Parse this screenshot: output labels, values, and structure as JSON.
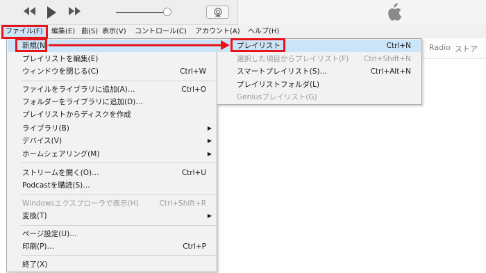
{
  "player": {
    "rewind_icon": "rewind-icon",
    "play_icon": "play-icon",
    "forward_icon": "fast-forward-icon",
    "airplay_icon": "airplay-icon",
    "apple_icon": "apple-logo",
    "volume_level": 0.92
  },
  "menubar": {
    "items": [
      "ファイル(F)",
      "編集(E)",
      "曲(S)",
      "表示(V)",
      "コントロール(C)",
      "アカウント(A)",
      "ヘルプ(H)"
    ]
  },
  "nav": {
    "radio": "Radio",
    "store": "ストア"
  },
  "file_menu": {
    "items": [
      {
        "label": "新規(N)",
        "shortcut": ""
      },
      {
        "label": "プレイリストを編集(E)",
        "shortcut": ""
      },
      {
        "label": "ウィンドウを閉じる(C)",
        "shortcut": "Ctrl+W"
      },
      {
        "label": "ファイルをライブラリに追加(A)…",
        "shortcut": "Ctrl+O"
      },
      {
        "label": "フォルダーをライブラリに追加(D)…",
        "shortcut": ""
      },
      {
        "label": "プレイリストからディスクを作成",
        "shortcut": ""
      },
      {
        "label": "ライブラリ(B)",
        "shortcut": ""
      },
      {
        "label": "デバイス(V)",
        "shortcut": ""
      },
      {
        "label": "ホームシェアリング(M)",
        "shortcut": ""
      },
      {
        "label": "ストリームを開く(O)…",
        "shortcut": "Ctrl+U"
      },
      {
        "label": "Podcastを購読(S)…",
        "shortcut": ""
      },
      {
        "label": "Windowsエクスプローラで表示(H)",
        "shortcut": "Ctrl+Shift+R"
      },
      {
        "label": "変換(T)",
        "shortcut": ""
      },
      {
        "label": "ページ設定(U)…",
        "shortcut": ""
      },
      {
        "label": "印刷(P)…",
        "shortcut": "Ctrl+P"
      },
      {
        "label": "終了(X)",
        "shortcut": ""
      }
    ]
  },
  "new_submenu": {
    "items": [
      {
        "label": "プレイリスト",
        "shortcut": "Ctrl+N"
      },
      {
        "label": "選択した項目からプレイリスト(F)",
        "shortcut": "Ctrl+Shift+N"
      },
      {
        "label": "スマートプレイリスト(S)…",
        "shortcut": "Ctrl+Alt+N"
      },
      {
        "label": "プレイリストフォルダ(L)",
        "shortcut": ""
      },
      {
        "label": "Geniusプレイリスト(G)",
        "shortcut": ""
      }
    ]
  },
  "colors": {
    "annotation": "#e8141b",
    "highlight": "#cce4f7",
    "disabled_text": "#9c9c9c"
  }
}
